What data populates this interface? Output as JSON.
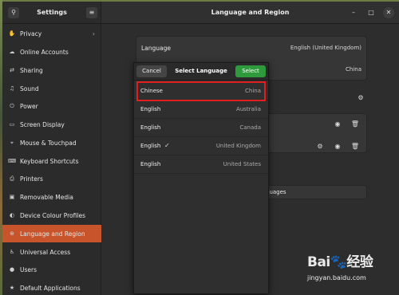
{
  "sidebar": {
    "title": "Settings",
    "items": [
      {
        "label": "Privacy",
        "icon": "hand-icon",
        "glyph": "✋",
        "chevron": "›"
      },
      {
        "label": "Online Accounts",
        "icon": "cloud-icon",
        "glyph": "☁"
      },
      {
        "label": "Sharing",
        "icon": "share-icon",
        "glyph": "⇄"
      },
      {
        "label": "Sound",
        "icon": "music-note-icon",
        "glyph": "♫"
      },
      {
        "label": "Power",
        "icon": "power-icon",
        "glyph": "⏻"
      },
      {
        "label": "Screen Display",
        "icon": "display-icon",
        "glyph": "▭"
      },
      {
        "label": "Mouse & Touchpad",
        "icon": "mouse-icon",
        "glyph": "⌖"
      },
      {
        "label": "Keyboard Shortcuts",
        "icon": "keyboard-icon",
        "glyph": "⌨"
      },
      {
        "label": "Printers",
        "icon": "printer-icon",
        "glyph": "⎙"
      },
      {
        "label": "Removable Media",
        "icon": "media-icon",
        "glyph": "▣"
      },
      {
        "label": "Device Colour Profiles",
        "icon": "color-profile-icon",
        "glyph": "◐"
      },
      {
        "label": "Language and Region",
        "icon": "globe-icon",
        "glyph": "⊕",
        "active": true
      },
      {
        "label": "Universal Access",
        "icon": "accessibility-icon",
        "glyph": "♿"
      },
      {
        "label": "Users",
        "icon": "user-icon",
        "glyph": "●"
      },
      {
        "label": "Default Applications",
        "icon": "star-icon",
        "glyph": "★"
      }
    ]
  },
  "header": {
    "title": "Language and Region",
    "search_glyph": "⚲",
    "menu_glyph": "≡",
    "minimize_glyph": "–",
    "maximize_glyph": "□",
    "close_glyph": "✕"
  },
  "main": {
    "language_label": "Language",
    "language_value": "English (United Kingdom)",
    "formats_value": "China",
    "gear_glyph": "⚙",
    "eye_glyph": "◉",
    "trash_glyph": "🗑",
    "manage_label": "guages"
  },
  "dialog": {
    "cancel_label": "Cancel",
    "title": "Select Language",
    "select_label": "Select",
    "check_glyph": "✓",
    "rows": [
      {
        "language": "Chinese",
        "region": "China",
        "highlighted": true
      },
      {
        "language": "English",
        "region": "Australia"
      },
      {
        "language": "English",
        "region": "Canada"
      },
      {
        "language": "English",
        "region": "United Kingdom",
        "checked": true
      },
      {
        "language": "English",
        "region": "United States"
      }
    ]
  },
  "watermark": {
    "logo": "Bai🐾经验",
    "url": "jingyan.baidu.com"
  },
  "colors": {
    "accent": "#c7542b",
    "select_green": "#2e9a3b",
    "highlight_red": "#e02020"
  }
}
